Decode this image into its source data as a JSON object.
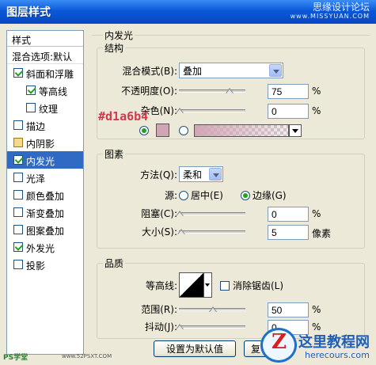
{
  "window": {
    "title": "图层样式",
    "watermark_line1": "思缘设计论坛",
    "watermark_line2": "www.MISSYUAN.COM"
  },
  "sidebar": {
    "header": "样式",
    "blend_options": "混合选项:默认",
    "items": [
      {
        "label": "斜面和浮雕",
        "checked": true
      },
      {
        "label": "等高线",
        "checked": true
      },
      {
        "label": "纹理",
        "checked": false
      },
      {
        "label": "描边",
        "checked": false
      },
      {
        "label": "内阴影",
        "checked": false
      },
      {
        "label": "内发光",
        "checked": true
      },
      {
        "label": "光泽",
        "checked": false
      },
      {
        "label": "颜色叠加",
        "checked": false
      },
      {
        "label": "渐变叠加",
        "checked": false
      },
      {
        "label": "图案叠加",
        "checked": false
      },
      {
        "label": "外发光",
        "checked": true
      },
      {
        "label": "投影",
        "checked": false
      }
    ]
  },
  "panel": {
    "title": "内发光",
    "structure": {
      "title": "结构",
      "blend_mode_label": "混合模式(B):",
      "blend_mode_value": "叠加",
      "opacity_label": "不透明度(O):",
      "opacity_value": "75",
      "opacity_unit": "%",
      "opacity_level": 75,
      "noise_label": "杂色(N):",
      "noise_value": "0",
      "noise_unit": "%",
      "noise_level": 0,
      "color_annotation": "#d1a6b4",
      "glow_color": "#d1a6b4"
    },
    "elements": {
      "title": "图素",
      "technique_label": "方法(Q):",
      "technique_value": "柔和",
      "source_label": "源:",
      "center_label": "居中(E)",
      "edge_label": "边缘(G)",
      "choke_label": "阻塞(C):",
      "choke_value": "0",
      "choke_unit": "%",
      "choke_level": 0,
      "size_label": "大小(S):",
      "size_value": "5",
      "size_unit": "像素",
      "size_level": 2
    },
    "quality": {
      "title": "品质",
      "contour_label": "等高线:",
      "antialias_label": "消除锯齿(L)",
      "range_label": "范围(R):",
      "range_value": "50",
      "range_unit": "%",
      "range_level": 50,
      "jitter_label": "抖动(J):",
      "jitter_value": "0",
      "jitter_unit": "%",
      "jitter_level": 0
    },
    "buttons": {
      "set_default": "设置为默认值",
      "reset": "复"
    }
  },
  "watermarks": {
    "bottom_left": "PS学堂",
    "bottom_left_site": "www.52PSXT.COM",
    "site_name": "这里教程网",
    "site_url": "herecours.com",
    "logo_letter": "Z"
  }
}
